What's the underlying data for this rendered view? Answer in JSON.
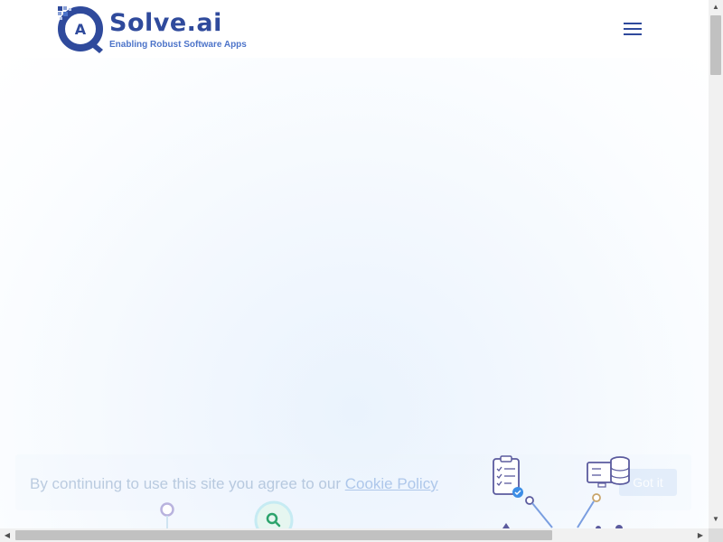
{
  "header": {
    "brand_name": "Solve.ai",
    "tagline": "Enabling Robust Software Apps",
    "logo_letter": "A",
    "menu_icon": "hamburger-menu-icon"
  },
  "cookie_banner": {
    "text": "By continuing to use this site you agree to our ",
    "link_text": "Cookie Policy",
    "accept_label": "Got it"
  },
  "icons": [
    "search-icon",
    "checklist-icon",
    "database-icon"
  ],
  "colors": {
    "brand_primary": "#2f4a9c",
    "brand_accent": "#4d74c9",
    "hero_background": "#f3f8fe"
  }
}
